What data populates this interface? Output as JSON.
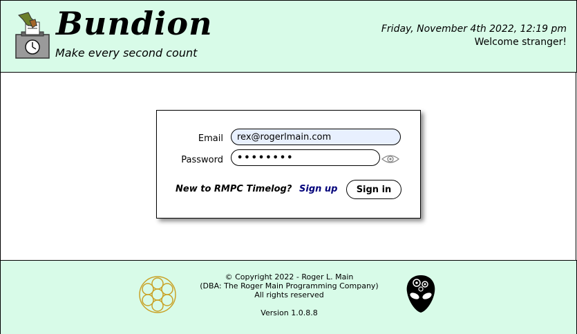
{
  "header": {
    "brand_name": "Bundion",
    "tagline": "Make every second count",
    "datetime": "Friday, November 4th 2022, 12:19 pm",
    "welcome": "Welcome stranger!"
  },
  "login": {
    "email_label": "Email",
    "email_value": "rex@rogerlmain.com",
    "password_label": "Password",
    "password_value": "••••••••",
    "signup_prompt": "New to RMPC Timelog?",
    "signup_link": "Sign up",
    "signin_label": "Sign in"
  },
  "footer": {
    "copyright": "© Copyright 2022 - Roger L. Main",
    "dba": "(DBA: The Roger Main Programming Company)",
    "rights": "All rights reserved",
    "version": "Version 1.0.8.8"
  },
  "icons": {
    "logo": "ballot-box-clock-icon",
    "eye": "eye-icon",
    "flower": "flower-of-life-icon",
    "alien": "alien-gear-icon"
  },
  "colors": {
    "header_bg": "#d8fbe8",
    "email_bg": "#e8f0fe",
    "signup_link": "#00007a"
  }
}
